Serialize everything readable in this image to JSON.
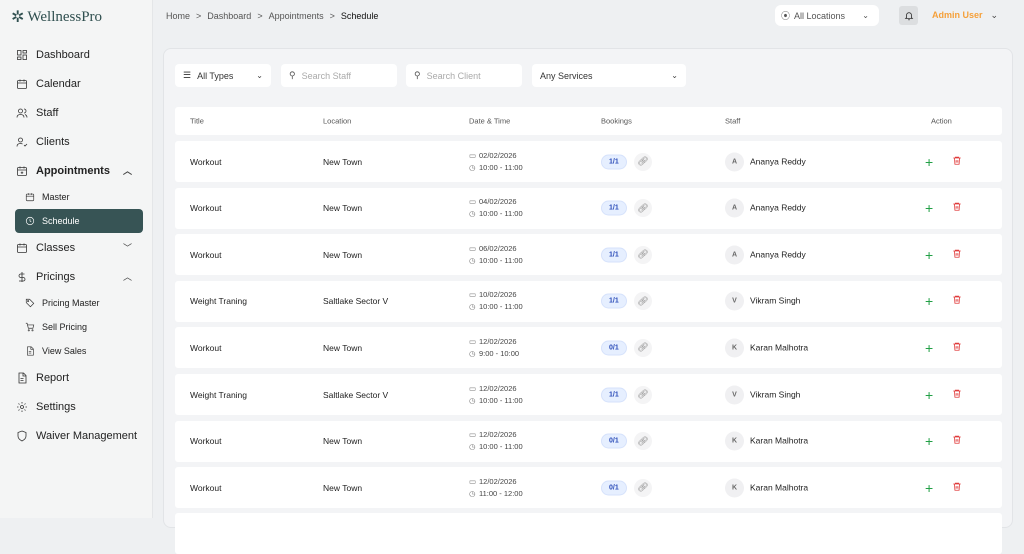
{
  "app": {
    "name": "WellnessPro"
  },
  "sidebar": {
    "items": [
      {
        "label": "Dashboard",
        "icon": "dashboard-icon"
      },
      {
        "label": "Calendar",
        "icon": "calendar-icon"
      },
      {
        "label": "Staff",
        "icon": "staff-icon"
      },
      {
        "label": "Clients",
        "icon": "clients-icon"
      },
      {
        "label": "Appointments",
        "icon": "appointments-icon",
        "expanded": true
      },
      {
        "label": "Master",
        "icon": "calendar-icon",
        "sub": true
      },
      {
        "label": "Schedule",
        "icon": "clock-icon",
        "sub": true,
        "active": true
      },
      {
        "label": "Classes",
        "icon": "calendar-icon",
        "collapsed": true
      },
      {
        "label": "Pricings",
        "icon": "dollar-icon",
        "expanded": true
      },
      {
        "label": "Pricing Master",
        "icon": "tag-icon",
        "sub": true
      },
      {
        "label": "Sell Pricing",
        "icon": "cart-icon",
        "sub": true
      },
      {
        "label": "View Sales",
        "icon": "file-icon",
        "sub": true
      },
      {
        "label": "Report",
        "icon": "file-icon"
      },
      {
        "label": "Settings",
        "icon": "gear-icon"
      },
      {
        "label": "Waiver Management",
        "icon": "shield-icon"
      }
    ]
  },
  "breadcrumb": [
    "Home",
    "Dashboard",
    "Appointments",
    "Schedule"
  ],
  "header": {
    "location": "All Locations",
    "user": "Admin User"
  },
  "filters": {
    "type": "All Types",
    "staff_placeholder": "Search Staff",
    "client_placeholder": "Search Client",
    "services": "Any Services"
  },
  "table": {
    "headers": [
      "Title",
      "Location",
      "Date & Time",
      "Bookings",
      "Staff",
      "Action"
    ],
    "rows": [
      {
        "title": "Workout",
        "location": "New Town",
        "date": "02/02/2026",
        "time": "10:00 - 11:00",
        "bookings": "1/1",
        "staff": "Ananya Reddy",
        "initial": "A"
      },
      {
        "title": "Workout",
        "location": "New Town",
        "date": "04/02/2026",
        "time": "10:00 - 11:00",
        "bookings": "1/1",
        "staff": "Ananya Reddy",
        "initial": "A"
      },
      {
        "title": "Workout",
        "location": "New Town",
        "date": "06/02/2026",
        "time": "10:00 - 11:00",
        "bookings": "1/1",
        "staff": "Ananya Reddy",
        "initial": "A"
      },
      {
        "title": "Weight Traning",
        "location": "Saltlake Sector V",
        "date": "10/02/2026",
        "time": "10:00 - 11:00",
        "bookings": "1/1",
        "staff": "Vikram Singh",
        "initial": "V"
      },
      {
        "title": "Workout",
        "location": "New Town",
        "date": "12/02/2026",
        "time": "9:00 - 10:00",
        "bookings": "0/1",
        "staff": "Karan Malhotra",
        "initial": "K"
      },
      {
        "title": "Weight Traning",
        "location": "Saltlake Sector V",
        "date": "12/02/2026",
        "time": "10:00 - 11:00",
        "bookings": "1/1",
        "staff": "Vikram Singh",
        "initial": "V"
      },
      {
        "title": "Workout",
        "location": "New Town",
        "date": "12/02/2026",
        "time": "10:00 - 11:00",
        "bookings": "0/1",
        "staff": "Karan Malhotra",
        "initial": "K"
      },
      {
        "title": "Workout",
        "location": "New Town",
        "date": "12/02/2026",
        "time": "11:00 - 12:00",
        "bookings": "0/1",
        "staff": "Karan Malhotra",
        "initial": "K"
      }
    ]
  }
}
